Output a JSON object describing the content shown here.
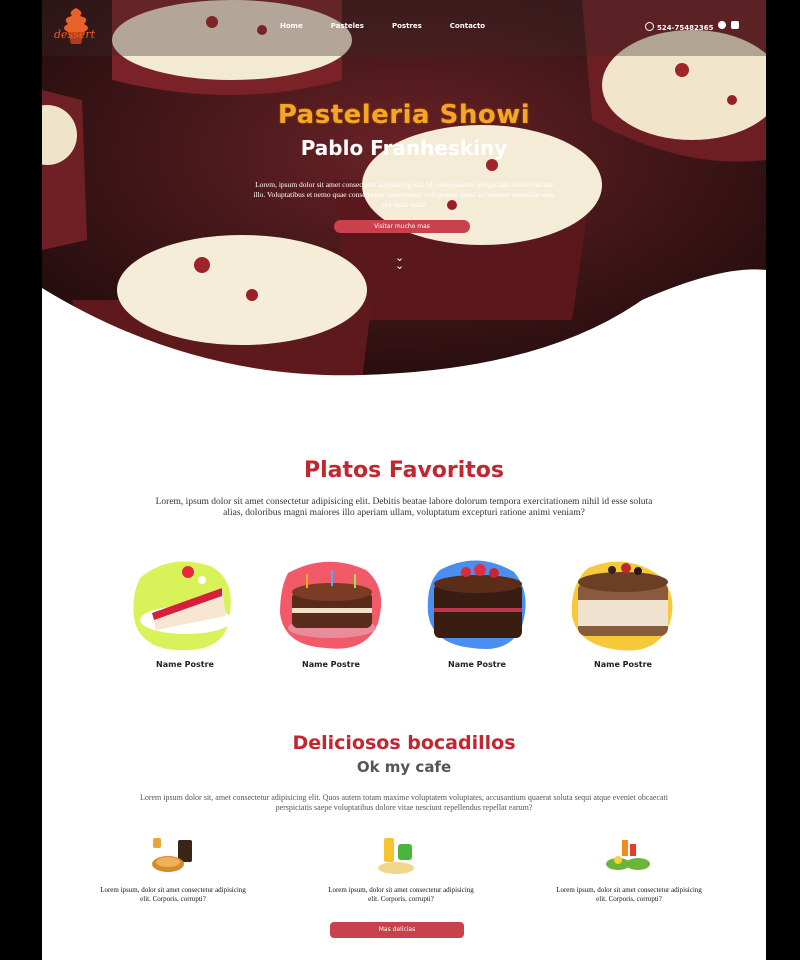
{
  "brand": {
    "logo_text": "dessert"
  },
  "nav": {
    "links": [
      "Home",
      "Pasteles",
      "Postres",
      "Contacto"
    ],
    "phone": "524-75482365"
  },
  "hero": {
    "title": "Pasteleria Showi",
    "subtitle": "Pablo Franheskiny",
    "text": "Lorem, ipsum dolor sit amet consectetur adipisicing elit. Id consequuntur perspiciatis dolore harum illo. Voluptatibus et nemo quae consequatur consectetur, voluptatem quasi accusamus molestias esse sed nulla quia?",
    "button": "Visitar mucho mas"
  },
  "favoritos": {
    "title": "Platos Favoritos",
    "text": "Lorem, ipsum dolor sit amet consectetur adipisicing elit. Debitis beatae labore dolorum tempora exercitationem nihil id esse soluta alias, doloribus magni maiores illo aperiam ullam, voluptatum excepturi ratione animi veniam?",
    "items": [
      {
        "name": "Name Postre",
        "blob": "#d9f25a"
      },
      {
        "name": "Name Postre",
        "blob": "#f25a6a"
      },
      {
        "name": "Name Postre",
        "blob": "#4a8ff0"
      },
      {
        "name": "Name Postre",
        "blob": "#f5c93a"
      }
    ]
  },
  "bocadillos": {
    "title": "Deliciosos bocadillos",
    "subtitle": "Ok my cafe",
    "text": "Lorem ipsum dolor sit, amet consectetur adipisicing elit. Quos autem totam maxime voluptatem voluptates, accusantium quaerat soluta sequi atque eveniet obcaecati perspiciatis saepe voluptatibus dolore vitae nesciunt repellendus repellat earum?",
    "items": [
      {
        "text": "Lorem ipsum, dolor sit amet consectetur adipisicing elit. Corporis, corrupti?"
      },
      {
        "text": "Lorem ipsum, dolor sit amet consectetur adipisicing elit. Corporis, corrupti?"
      },
      {
        "text": "Lorem ipsum, dolor sit amet consectetur adipisicing elit. Corporis, corrupti?"
      }
    ],
    "button": "Mas delicias"
  },
  "colors": {
    "accent": "#c2262e",
    "button": "#c9414a",
    "title_orange": "#f5a623"
  }
}
